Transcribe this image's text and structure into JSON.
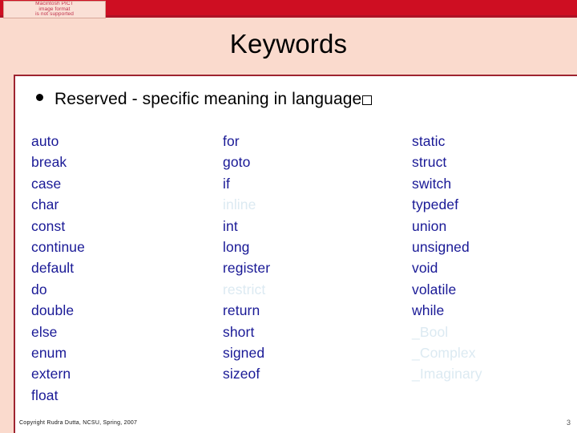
{
  "banner": {
    "color": "#CE0E22",
    "rule_color": "#AE1226"
  },
  "pict_placeholder": {
    "line1": "Macintosh PICT",
    "line2": "image format",
    "line3": "is not supported"
  },
  "slide": {
    "title": "Keywords",
    "background": "#FADACD",
    "content_background": "#FFFFFF",
    "frame_border_color": "#9E2430"
  },
  "bullet": {
    "text": "Reserved - specific meaning in language",
    "trailing_glyph": "missing-glyph-box"
  },
  "colors": {
    "keyword": "#191996",
    "keyword_faded": "#DCEAF2",
    "title": "#000000"
  },
  "keyword_columns": [
    {
      "id": "column-1",
      "items": [
        {
          "label": "auto",
          "faded": false
        },
        {
          "label": "break",
          "faded": false
        },
        {
          "label": "case",
          "faded": false
        },
        {
          "label": "char",
          "faded": false
        },
        {
          "label": "const",
          "faded": false
        },
        {
          "label": "continue",
          "faded": false
        },
        {
          "label": "default",
          "faded": false
        },
        {
          "label": "do",
          "faded": false
        },
        {
          "label": "double",
          "faded": false
        },
        {
          "label": "else",
          "faded": false
        },
        {
          "label": "enum",
          "faded": false
        },
        {
          "label": "extern",
          "faded": false
        },
        {
          "label": "float",
          "faded": false
        }
      ]
    },
    {
      "id": "column-2",
      "items": [
        {
          "label": "for",
          "faded": false
        },
        {
          "label": "goto",
          "faded": false
        },
        {
          "label": "if",
          "faded": false
        },
        {
          "label": "inline",
          "faded": true
        },
        {
          "label": "int",
          "faded": false
        },
        {
          "label": "long",
          "faded": false
        },
        {
          "label": "register",
          "faded": false
        },
        {
          "label": "restrict",
          "faded": true
        },
        {
          "label": "return",
          "faded": false
        },
        {
          "label": "short",
          "faded": false
        },
        {
          "label": "signed",
          "faded": false
        },
        {
          "label": "sizeof",
          "faded": false
        }
      ]
    },
    {
      "id": "column-3",
      "items": [
        {
          "label": "static",
          "faded": false
        },
        {
          "label": "struct",
          "faded": false
        },
        {
          "label": "switch",
          "faded": false
        },
        {
          "label": "typedef",
          "faded": false
        },
        {
          "label": "union",
          "faded": false
        },
        {
          "label": "unsigned",
          "faded": false
        },
        {
          "label": "void",
          "faded": false
        },
        {
          "label": "volatile",
          "faded": false
        },
        {
          "label": "while",
          "faded": false
        },
        {
          "label": "_Bool",
          "faded": true
        },
        {
          "label": "_Complex",
          "faded": true
        },
        {
          "label": "_Imaginary",
          "faded": true
        }
      ]
    }
  ],
  "footer": {
    "copyright": "Copyright Rudra Dutta, NCSU, Spring, 2007",
    "page_number": "3"
  }
}
